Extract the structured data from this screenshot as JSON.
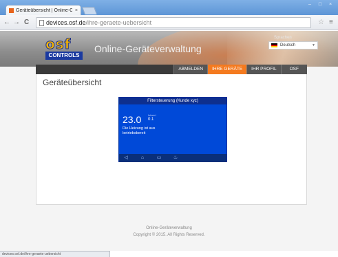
{
  "browser": {
    "tab_title": "Geräteübersicht | Online-Gr",
    "tab_close": "×",
    "url_host": "devices.osf.de",
    "url_path": "/ihre-geraete-uebersicht",
    "back_icon": "←",
    "forward_icon": "→",
    "reload_icon": "C",
    "star_icon": "☆",
    "menu_icon": "≡",
    "window_buttons": [
      "–",
      "□",
      "×"
    ],
    "status_url": "devices.osf.de/ihre-geraete-uebersicht"
  },
  "header": {
    "logo_letters": "osf",
    "logo_subtitle": "CONTROLS",
    "title": "Online-Geräteverwaltung",
    "language_label": "Sprachen",
    "language_value": "Deutsch"
  },
  "nav": {
    "items": [
      {
        "label": "ABMELDEN",
        "active": false
      },
      {
        "label": "IHRE GERÄTE",
        "active": true
      },
      {
        "label": "IHR PROFIL",
        "active": false
      },
      {
        "label": "OSF",
        "active": false
      }
    ]
  },
  "main": {
    "title": "Geräteübersicht"
  },
  "device": {
    "header": "Filtersteuerung (Kunde xyz)",
    "temperature": "23.0",
    "ist_label": "Istwert",
    "ist_value": "0.1",
    "status_line1": "Die Heizung ist aus",
    "status_line2": "betriebsbereit",
    "footer_icons": [
      "◁",
      "⌂",
      "▭",
      "♨"
    ]
  },
  "footer": {
    "line1": "Online-Geräteverwaltung",
    "line2": "Copyright © 2015. All Rights Reserved."
  },
  "colors": {
    "accent_orange": "#f47a1f",
    "device_blue": "#0049d8"
  }
}
